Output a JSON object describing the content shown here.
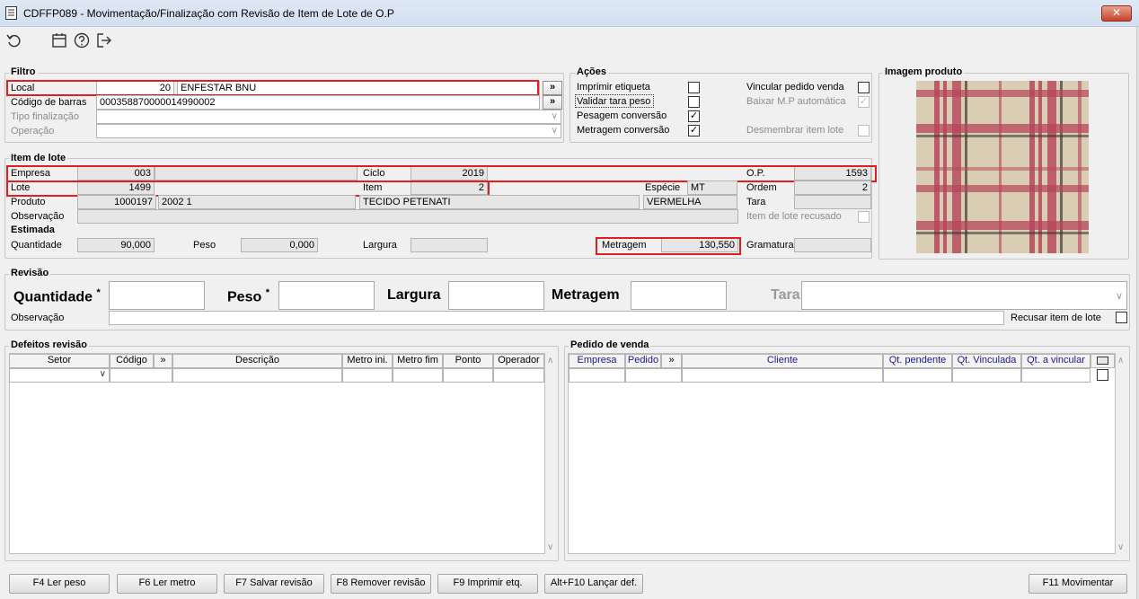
{
  "window": {
    "title": "CDFFP089 - Movimentação/Finalização com Revisão de Item de Lote de O.P",
    "close_label": "✕"
  },
  "toolbar": {
    "icons": [
      "refresh-icon",
      "calendar-icon",
      "help-icon",
      "exit-icon"
    ]
  },
  "filtro": {
    "title": "Filtro",
    "local_label": "Local",
    "local_code": "20",
    "local_name": "ENFESTAR BNU",
    "codigo_barras_label": "Código de barras",
    "codigo_barras_value": "000358870000014990002",
    "tipo_finalizacao_label": "Tipo finalização",
    "operacao_label": "Operação",
    "expand_label": "»"
  },
  "acoes": {
    "title": "Ações",
    "imprimir_etiqueta": {
      "label": "Imprimir etiqueta",
      "checked": false
    },
    "validar_tara_peso": {
      "label": "Validar tara peso",
      "checked": false
    },
    "pesagem_conversao": {
      "label": "Pesagem conversão",
      "checked": true
    },
    "metragem_conversao": {
      "label": "Metragem conversão",
      "checked": true
    },
    "vincular_pedido_venda": {
      "label": "Vincular pedido venda",
      "checked": false
    },
    "baixar_mp_automatica": {
      "label": "Baixar M.P automática",
      "checked": true
    },
    "desmembrar_item_lote": {
      "label": "Desmembrar item lote",
      "checked": false
    }
  },
  "imagem": {
    "title": "Imagem produto",
    "colors": {
      "base": "#d9cdb3",
      "red": "#b5455a",
      "dark": "#3f3a33"
    }
  },
  "item_lote": {
    "title": "Item de lote",
    "empresa_label": "Empresa",
    "empresa_value": "003",
    "ciclo_label": "Ciclo",
    "ciclo_value": "2019",
    "op_label": "O.P.",
    "op_value": "1593",
    "lote_label": "Lote",
    "lote_value": "1499",
    "item_label": "Item",
    "item_value": "2",
    "especie_label": "Espécie",
    "especie_value": "MT",
    "ordem_label": "Ordem",
    "ordem_value": "2",
    "produto_label": "Produto",
    "produto_code": "1000197",
    "produto_ref": "2002 1",
    "produto_desc": "TECIDO PETENATI",
    "produto_cor": "VERMELHA",
    "tara_label": "Tara",
    "observacao_label": "Observação",
    "item_recusado_label": "Item de lote recusado"
  },
  "estimada": {
    "title": "Estimada",
    "quantidade_label": "Quantidade",
    "quantidade_value": "90,000",
    "peso_label": "Peso",
    "peso_value": "0,000",
    "largura_label": "Largura",
    "metragem_label": "Metragem",
    "metragem_value": "130,550",
    "gramatura_label": "Gramatura"
  },
  "revisao": {
    "title": "Revisão",
    "quantidade_label": "Quantidade",
    "peso_label": "Peso",
    "required_mark": "*",
    "largura_label": "Largura",
    "metragem_label": "Metragem",
    "tara_label": "Tara",
    "observacao_label": "Observação",
    "recusar_label": "Recusar item de lote"
  },
  "defeitos": {
    "title": "Defeitos revisão",
    "columns": [
      "Setor",
      "Código",
      "»",
      "Descrição",
      "Metro ini.",
      "Metro fim",
      "Ponto",
      "Operador"
    ]
  },
  "pedido": {
    "title": "Pedido de venda",
    "columns": [
      "Empresa",
      "Pedido",
      "»",
      "Cliente",
      "Qt. pendente",
      "Qt. Vinculada",
      "Qt. a vincular"
    ]
  },
  "footer": {
    "f4": "F4 Ler peso",
    "f6": "F6 Ler metro",
    "f7": "F7 Salvar revisão",
    "f8": "F8 Remover revisão",
    "f9": "F9 Imprimir etq.",
    "altf10": "Alt+F10 Lançar def.",
    "f11": "F11 Movimentar"
  }
}
